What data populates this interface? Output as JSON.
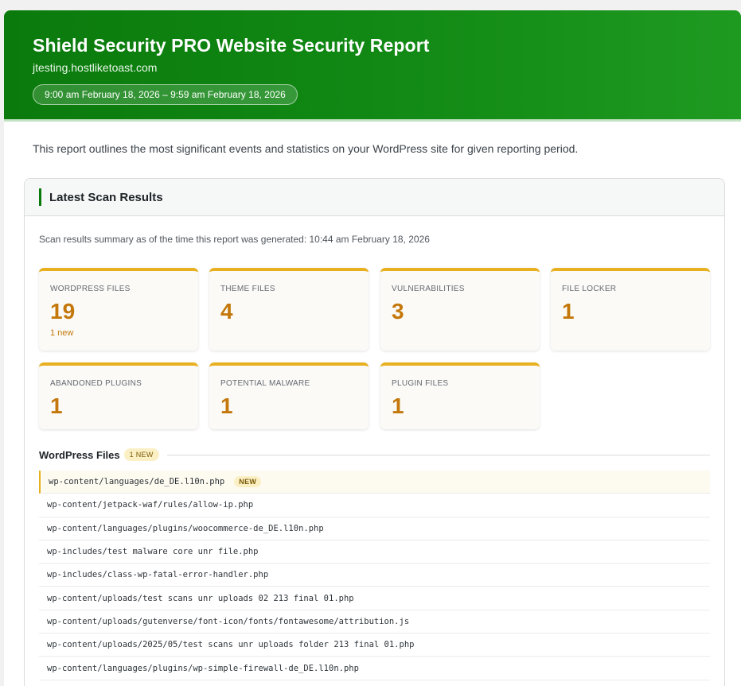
{
  "header": {
    "title": "Shield Security PRO Website Security Report",
    "domain": "jtesting.hostliketoast.com",
    "period": "9:00 am February 18, 2026 – 9:59 am February 18, 2026"
  },
  "intro": "This report outlines the most significant events and statistics on your WordPress site for given reporting period.",
  "scan_panel": {
    "title": "Latest Scan Results",
    "summary": "Scan results summary as of the time this report was generated: 10:44 am February 18, 2026",
    "stats": [
      {
        "label": "WordPress Files",
        "value": "19",
        "note": "1 new"
      },
      {
        "label": "Theme Files",
        "value": "4",
        "note": ""
      },
      {
        "label": "Vulnerabilities",
        "value": "3",
        "note": ""
      },
      {
        "label": "File Locker",
        "value": "1",
        "note": ""
      },
      {
        "label": "Abandoned Plugins",
        "value": "1",
        "note": ""
      },
      {
        "label": "Potential Malware",
        "value": "1",
        "note": ""
      },
      {
        "label": "Plugin Files",
        "value": "1",
        "note": ""
      }
    ],
    "files_section": {
      "title": "WordPress Files",
      "chip": "1 NEW",
      "new_badge": "NEW",
      "files": [
        "wp-content/languages/de_DE.l10n.php",
        "wp-content/jetpack-waf/rules/allow-ip.php",
        "wp-content/languages/plugins/woocommerce-de_DE.l10n.php",
        "wp-includes/test malware core unr file.php",
        "wp-includes/class-wp-fatal-error-handler.php",
        "wp-content/uploads/test scans unr uploads 02 213 final 01.php",
        "wp-content/uploads/gutenverse/font-icon/fonts/fontawesome/attribution.js",
        "wp-content/uploads/2025/05/test scans unr uploads folder 213 final 01.php",
        "wp-content/languages/plugins/wp-simple-firewall-de_DE.l10n.php"
      ]
    }
  },
  "colors": {
    "header_green": "#0a7a0c",
    "accent_amber": "#e8b01e",
    "stat_value": "#c4780b"
  }
}
